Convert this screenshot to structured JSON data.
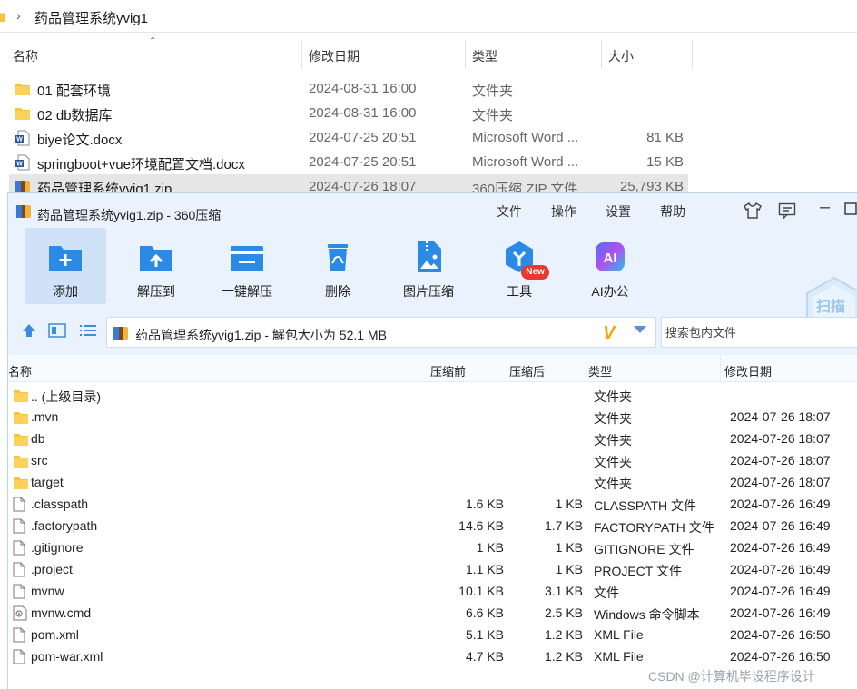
{
  "explorer": {
    "breadcrumb": "药品管理系统yvig1",
    "columns": {
      "name": "名称",
      "modified": "修改日期",
      "type": "类型",
      "size": "大小"
    },
    "files": [
      {
        "icon": "folder-icon",
        "name": "01 配套环境",
        "modified": "2024-08-31 16:00",
        "type": "文件夹",
        "size": ""
      },
      {
        "icon": "folder-icon",
        "name": "02 db数据库",
        "modified": "2024-08-31 16:00",
        "type": "文件夹",
        "size": ""
      },
      {
        "icon": "word-doc-icon",
        "name": "biye论文.docx",
        "modified": "2024-07-25 20:51",
        "type": "Microsoft Word ...",
        "size": "81 KB"
      },
      {
        "icon": "word-doc-icon",
        "name": "springboot+vue环境配置文档.docx",
        "modified": "2024-07-25 20:51",
        "type": "Microsoft Word ...",
        "size": "15 KB"
      },
      {
        "icon": "zip-archive-icon",
        "name": "药品管理系统yvig1.zip",
        "modified": "2024-07-26 18:07",
        "type": "360压缩 ZIP 文件",
        "size": "25,793 KB",
        "selected": true
      }
    ]
  },
  "zip_window": {
    "title": "药品管理系统yvig1.zip - 360压缩",
    "menu": [
      "文件",
      "操作",
      "设置",
      "帮助"
    ],
    "toolbar": [
      {
        "label": "添加",
        "icon": "add-folder-icon"
      },
      {
        "label": "解压到",
        "icon": "extract-to-icon"
      },
      {
        "label": "一键解压",
        "icon": "one-click-extract-icon"
      },
      {
        "label": "删除",
        "icon": "recycle-bin-icon"
      },
      {
        "label": "图片压缩",
        "icon": "image-compress-icon"
      },
      {
        "label": "工具",
        "icon": "tools-icon",
        "badge": "New"
      },
      {
        "label": "AI办公",
        "icon": "ai-office-icon",
        "icon_text": "AI"
      }
    ],
    "scan_label": "扫描",
    "path_text": "药品管理系统yvig1.zip - 解包大小为 52.1 MB",
    "search_placeholder": "搜索包内文件",
    "columns": {
      "name": "名称",
      "compressed_before": "压缩前",
      "compressed_after": "压缩后",
      "type": "类型",
      "modified": "修改日期"
    },
    "entries": [
      {
        "icon": "folder-icon",
        "name": ".. (上级目录)",
        "before": "",
        "after": "",
        "type": "文件夹",
        "modified": ""
      },
      {
        "icon": "folder-icon",
        "name": ".mvn",
        "before": "",
        "after": "",
        "type": "文件夹",
        "modified": "2024-07-26 18:07"
      },
      {
        "icon": "folder-icon",
        "name": "db",
        "before": "",
        "after": "",
        "type": "文件夹",
        "modified": "2024-07-26 18:07"
      },
      {
        "icon": "folder-icon",
        "name": "src",
        "before": "",
        "after": "",
        "type": "文件夹",
        "modified": "2024-07-26 18:07"
      },
      {
        "icon": "folder-icon",
        "name": "target",
        "before": "",
        "after": "",
        "type": "文件夹",
        "modified": "2024-07-26 18:07"
      },
      {
        "icon": "file-icon",
        "name": ".classpath",
        "before": "1.6 KB",
        "after": "1 KB",
        "type": "CLASSPATH 文件",
        "modified": "2024-07-26 16:49"
      },
      {
        "icon": "file-icon",
        "name": ".factorypath",
        "before": "14.6 KB",
        "after": "1.7 KB",
        "type": "FACTORYPATH 文件",
        "modified": "2024-07-26 16:49"
      },
      {
        "icon": "file-icon",
        "name": ".gitignore",
        "before": "1 KB",
        "after": "1 KB",
        "type": "GITIGNORE 文件",
        "modified": "2024-07-26 16:49"
      },
      {
        "icon": "file-icon",
        "name": ".project",
        "before": "1.1 KB",
        "after": "1 KB",
        "type": "PROJECT 文件",
        "modified": "2024-07-26 16:49"
      },
      {
        "icon": "file-icon",
        "name": "mvnw",
        "before": "10.1 KB",
        "after": "3.1 KB",
        "type": "文件",
        "modified": "2024-07-26 16:49"
      },
      {
        "icon": "cmd-script-icon",
        "name": "mvnw.cmd",
        "before": "6.6 KB",
        "after": "2.5 KB",
        "type": "Windows 命令脚本",
        "modified": "2024-07-26 16:49"
      },
      {
        "icon": "file-icon",
        "name": "pom.xml",
        "before": "5.1 KB",
        "after": "1.2 KB",
        "type": "XML File",
        "modified": "2024-07-26 16:50"
      },
      {
        "icon": "file-icon",
        "name": "pom-war.xml",
        "before": "4.7 KB",
        "after": "1.2 KB",
        "type": "XML File",
        "modified": "2024-07-26 16:50"
      }
    ]
  },
  "watermark": "CSDN @计算机毕设程序设计",
  "colors": {
    "accent": "#2a8ae6",
    "folder": "#f5c342",
    "window_bg": "#eaf3fd",
    "selection": "#e6e6e6"
  }
}
